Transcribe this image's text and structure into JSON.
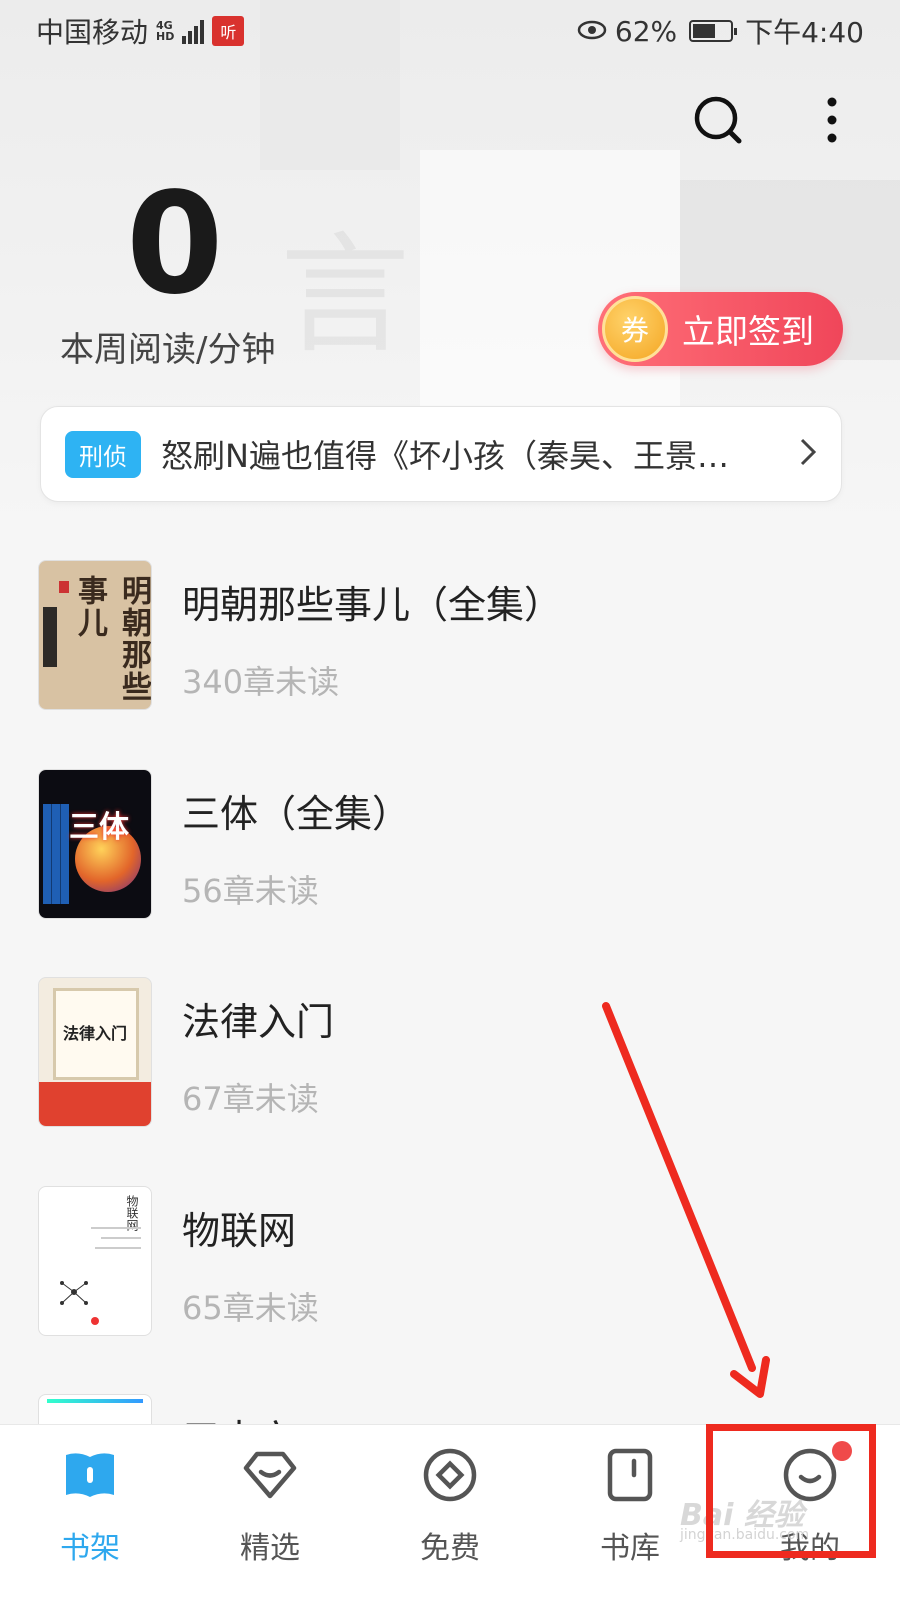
{
  "status_bar": {
    "carrier": "中国移动",
    "network_type": "4G",
    "network_sub": "HD",
    "listen_badge": "听",
    "battery_percent": "62%",
    "battery_level": 0.62,
    "time": "下午4:40"
  },
  "header": {
    "search_icon": "search-icon",
    "more_icon": "more-vertical-icon"
  },
  "reading": {
    "minutes": "0",
    "label": "本周阅读/分钟"
  },
  "checkin": {
    "coin_label": "券",
    "label": "立即签到"
  },
  "promo": {
    "tag": "刑侦",
    "text": "怒刷N遍也值得《坏小孩（秦昊、王景…"
  },
  "books": [
    {
      "title": "明朝那些事儿（全集）",
      "unread": "340章未读",
      "cover_text": "明朝那些事儿"
    },
    {
      "title": "三体（全集）",
      "unread": "56章未读",
      "cover_text": "三体"
    },
    {
      "title": "法律入门",
      "unread": "67章未读",
      "cover_text": "法律入门"
    },
    {
      "title": "物联网",
      "unread": "65章未读",
      "cover_text": "物联网"
    },
    {
      "title": "三十六",
      "unread": "",
      "cover_text": ""
    }
  ],
  "nav": {
    "items": [
      {
        "label": "书架",
        "icon": "bookshelf-icon",
        "active": true
      },
      {
        "label": "精选",
        "icon": "featured-icon",
        "active": false
      },
      {
        "label": "免费",
        "icon": "free-icon",
        "active": false
      },
      {
        "label": "书库",
        "icon": "library-icon",
        "active": false
      },
      {
        "label": "我的",
        "icon": "profile-icon",
        "active": false
      }
    ]
  },
  "watermark": {
    "text": "Bai 经验",
    "sub": "jingyan.baidu.com"
  },
  "colors": {
    "accent": "#2ea8ee",
    "checkin_start": "#ff6f78",
    "checkin_end": "#f0465a",
    "annotation": "#ee2a1f",
    "promo_tag": "#2eb3f3"
  }
}
